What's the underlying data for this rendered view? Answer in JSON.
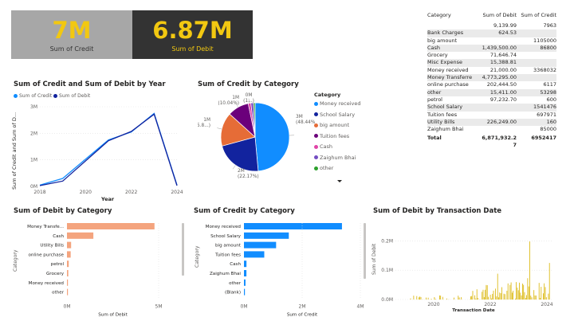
{
  "kpis": {
    "credit": {
      "value": "7M",
      "label": "Sum of Credit"
    },
    "debit": {
      "value": "6.87M",
      "label": "Sum of Debit"
    }
  },
  "colors": {
    "accent_yellow": "#f2c811",
    "credit_line": "#118dff",
    "debit_line": "#12239e",
    "debit_bar": "#f4a47e",
    "credit_bar": "#118dff",
    "txn_bar": "#d9b300"
  },
  "table": {
    "headers": [
      "Category",
      "Sum of Debit",
      "Sum of Credit"
    ],
    "rows": [
      {
        "category": "",
        "debit": "9,139.99",
        "credit": "7963"
      },
      {
        "category": "Bank Charges",
        "debit": "624.53",
        "credit": ""
      },
      {
        "category": "big amount",
        "debit": "",
        "credit": "1105000"
      },
      {
        "category": "Cash",
        "debit": "1,439,500.00",
        "credit": "86800"
      },
      {
        "category": "Grocery",
        "debit": "71,646.74",
        "credit": ""
      },
      {
        "category": "Misc Expense",
        "debit": "15,388.81",
        "credit": ""
      },
      {
        "category": "Money received",
        "debit": "21,000.00",
        "credit": "3368032"
      },
      {
        "category": "Money Transferred",
        "debit": "4,773,295.00",
        "credit": ""
      },
      {
        "category": "online purchase",
        "debit": "202,444.50",
        "credit": "6117"
      },
      {
        "category": "other",
        "debit": "15,411.00",
        "credit": "53298"
      },
      {
        "category": "petrol",
        "debit": "97,232.70",
        "credit": "600"
      },
      {
        "category": "School Salary",
        "debit": "",
        "credit": "1541476"
      },
      {
        "category": "Tuition fees",
        "debit": "",
        "credit": "697971"
      },
      {
        "category": "Utility Bills",
        "debit": "226,249.00",
        "credit": "160"
      },
      {
        "category": "Zaighum Bhai",
        "debit": "",
        "credit": "85000"
      }
    ],
    "total": {
      "category": "Total",
      "debit": "6,871,932.2",
      "debit_cont": "7",
      "credit": "6952417"
    }
  },
  "chart_data": [
    {
      "type": "line",
      "title": "Sum of Credit and Sum of Debit by Year",
      "xlabel": "Year",
      "ylabel": "Sum of Credit and Sum of D...",
      "x": [
        2018,
        2019,
        2021,
        2022,
        2023,
        2024
      ],
      "series": [
        {
          "name": "Sum of Credit",
          "values": [
            0.05,
            0.3,
            1.75,
            2.05,
            2.75,
            0.05
          ]
        },
        {
          "name": "Sum of Debit",
          "values": [
            0.03,
            0.2,
            1.72,
            2.07,
            2.72,
            0.03
          ]
        }
      ],
      "x_ticks": [
        "2018",
        "2020",
        "2022",
        "2024"
      ],
      "y_ticks": [
        "0M",
        "1M",
        "2M",
        "3M"
      ],
      "ylim": [
        0,
        3
      ],
      "xlim": [
        2018,
        2024
      ],
      "legend": "top-left"
    },
    {
      "type": "pie",
      "title": "Sum of Credit by Category",
      "legend_title": "Category",
      "categories": [
        "Money received",
        "School Salary",
        "big amount",
        "Tuition fees",
        "Cash",
        "Zaighum Bhai",
        "other"
      ],
      "values": [
        3368032,
        1541476,
        1105000,
        697971,
        86800,
        85000,
        53298
      ],
      "colors": [
        "#118dff",
        "#12239e",
        "#e66c37",
        "#6b007b",
        "#e044a7",
        "#744ec2",
        "#2ca02c"
      ],
      "slice_labels": [
        {
          "value": "3M",
          "pct": "(48.44%)"
        },
        {
          "value": "2M",
          "pct": "(22.17%)"
        },
        {
          "value": "1M",
          "pct": "(15.8...)"
        },
        {
          "value": "1M",
          "pct": "(10.04%)"
        },
        {
          "value": "0M",
          "pct": "(1...)"
        }
      ]
    },
    {
      "type": "bar",
      "title": "Sum of Debit by Category",
      "ylabel": "Category",
      "xlabel": "Sum of Debit",
      "categories": [
        "Money Transfe...",
        "Cash",
        "Utility Bills",
        "online purchase",
        "petrol",
        "Grocery",
        "Money received",
        "other"
      ],
      "values": [
        4773295,
        1439500,
        226249,
        202444.5,
        97232.7,
        71646.74,
        21000,
        15411
      ],
      "x_ticks": [
        "0M",
        "5M"
      ],
      "xlim": [
        0,
        5000000
      ]
    },
    {
      "type": "bar",
      "title": "Sum of Credit by Category",
      "ylabel": "Category",
      "xlabel": "Sum of Credit",
      "categories": [
        "Money received",
        "School Salary",
        "big amount",
        "Tuition fees",
        "Cash",
        "Zaighum Bhai",
        "other",
        "(Blank)"
      ],
      "values": [
        3368032,
        1541476,
        1105000,
        697971,
        86800,
        85000,
        53298,
        7963
      ],
      "x_ticks": [
        "0M",
        "2M",
        "4M"
      ],
      "xlim": [
        0,
        4000000
      ]
    },
    {
      "type": "bar",
      "title": "Sum of Debit by Transaction Date",
      "ylabel": "Sum of Debit",
      "xlabel": "Transaction Date",
      "x_ticks": [
        "2020",
        "2022",
        "2024"
      ],
      "y_ticks": [
        "0.0M",
        "0.1M",
        "0.2M"
      ],
      "ylim": [
        0,
        0.25
      ]
    }
  ]
}
